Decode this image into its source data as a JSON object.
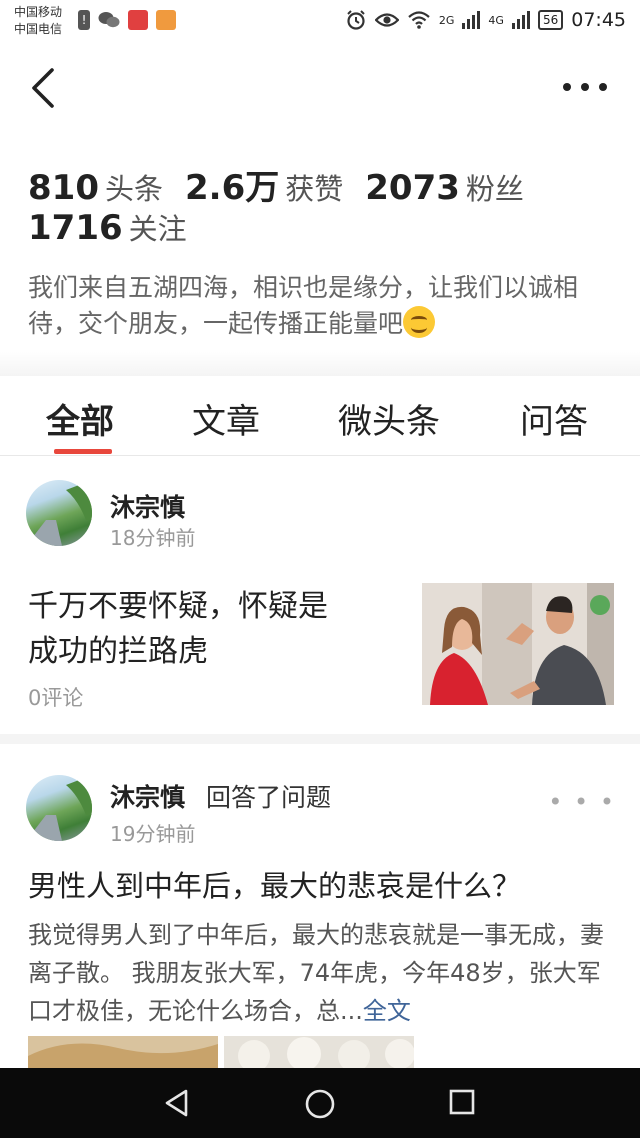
{
  "status_bar": {
    "carrier_1": "中国移动",
    "carrier_2": "中国电信",
    "notification_icons": [
      "alert-icon",
      "wechat-icon",
      "app-red-icon",
      "app-orange-icon"
    ],
    "system_icons": [
      "alarm-icon",
      "eye-icon",
      "wifi-icon",
      "signal-2g-icon",
      "signal-4g-icon"
    ],
    "signal_2g_label": "2G",
    "signal_4g_label": "4G",
    "battery": "56",
    "time": "07:45"
  },
  "nav": {
    "back_icon": "chevron-left-icon",
    "more_icon": "more-horizontal-icon"
  },
  "profile": {
    "stats": [
      {
        "value": "810",
        "label": "头条"
      },
      {
        "value": "2.6万",
        "label": "获赞"
      },
      {
        "value": "2073",
        "label": "粉丝"
      },
      {
        "value": "1716",
        "label": "关注"
      }
    ],
    "bio": "我们来自五湖四海，相识也是缘分，让我们以诚相待，交个朋友，一起传播正能量吧"
  },
  "tabs": {
    "items": [
      {
        "label": "全部",
        "active": true
      },
      {
        "label": "文章",
        "active": false
      },
      {
        "label": "微头条",
        "active": false
      },
      {
        "label": "问答",
        "active": false
      }
    ],
    "accent_color": "#e8473c"
  },
  "feed": {
    "post1": {
      "author": "沐宗慎",
      "time": "18分钟前",
      "title_line1": "千万不要怀疑，怀疑是",
      "title_line2": "成功的拦路虎",
      "comments": "0评论"
    },
    "post2": {
      "author": "沐宗慎",
      "action": "回答了问题",
      "time": "19分钟前",
      "title": "男性人到中年后，最大的悲哀是什么？",
      "excerpt": "我觉得男人到了中年后，最大的悲哀就是一事无成，妻离子散。 我朋友张大军，74年虎，今年48岁，张大军口才极佳，无论什么场合，总...",
      "full_text_link": "全文",
      "link_color": "#406599"
    }
  },
  "system_nav": {
    "buttons": [
      "back-triangle-icon",
      "home-circle-icon",
      "recents-square-icon"
    ]
  }
}
